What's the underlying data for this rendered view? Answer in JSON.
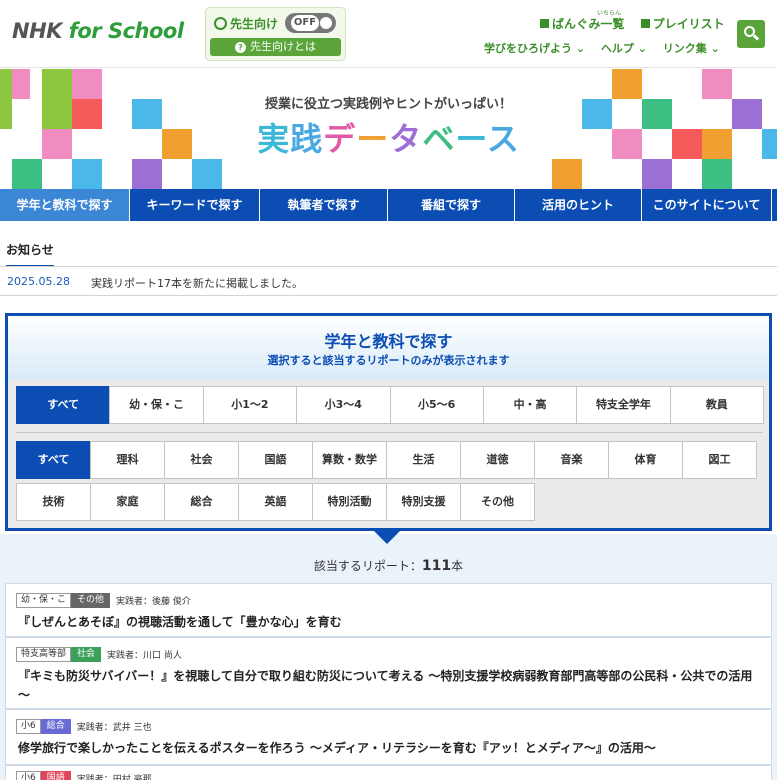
{
  "header": {
    "logo_main": "NHK ",
    "logo_accent": "for School",
    "teacher_label": "先生向け",
    "toggle_text": "OFF",
    "teacher_about": "先生向けとは",
    "top_links": [
      "ばんぐみ一覧",
      "プレイリスト"
    ],
    "ruby": "いちらん",
    "sub_links": [
      "学びをひろげよう ⌄",
      "ヘルプ ⌄",
      "リンク集 ⌄"
    ]
  },
  "banner": {
    "tagline": "授業に役立つ実践例やヒントがいっぱい！",
    "title_chars": [
      "実",
      "践",
      "デ",
      "ー",
      "タ",
      "ベ",
      "ー",
      "ス"
    ]
  },
  "nav": [
    "学年と教科で探す",
    "キーワードで探す",
    "執筆者で探す",
    "番組で探す",
    "活用のヒント",
    "このサイトについて"
  ],
  "notice": {
    "heading": "お知らせ",
    "date": "2025.05.28",
    "text": "実践リポート17本を新たに掲載しました。"
  },
  "filter": {
    "title": "学年と教科で探す",
    "subtitle": "選択すると該当するリポートのみが表示されます",
    "grades": [
      "すべて",
      "幼・保・こ",
      "小1〜2",
      "小3〜4",
      "小5〜6",
      "中・高",
      "特支全学年",
      "教員"
    ],
    "subjects_row1": [
      "すべて",
      "理科",
      "社会",
      "国語",
      "算数・数学",
      "生活",
      "道徳",
      "音楽",
      "体育",
      "図工"
    ],
    "subjects_row2": [
      "技術",
      "家庭",
      "総合",
      "英語",
      "特別活動",
      "特別支援",
      "その他"
    ]
  },
  "results": {
    "count_prefix": "該当するリポート：",
    "count": "111",
    "count_suffix": "本",
    "items": [
      {
        "grade": "幼・保・こ",
        "subject": "その他",
        "subject_color": "#666666",
        "author": "実践者：後藤 俊介",
        "title": "『しぜんとあそぼ』の視聴活動を通して「豊かな心」を育む"
      },
      {
        "grade": "特支高等部",
        "subject": "社会",
        "subject_color": "#3aa05a",
        "author": "実践者：川口 尚人",
        "title": "『キミも防災サバイバー！』を視聴して自分で取り組む防災について考える ～特別支援学校病弱教育部門高等部の公民科・公共での活用～"
      },
      {
        "grade": "小6",
        "subject": "総合",
        "subject_color": "#6a6ad4",
        "author": "実践者：武井 三也",
        "title": "修学旅行で楽しかったことを伝えるポスターを作ろう ～メディア・リテラシーを育む『アッ！とメディア～』の活用～"
      },
      {
        "grade": "小6",
        "subject": "国語",
        "subject_color": "#e0455a",
        "author": "実践者：田村 豪那",
        "title": ""
      }
    ]
  },
  "colors": {
    "nav_blue": "#0b4db3",
    "nav_active": "#3c86d6",
    "brand_green": "#3b8f2a"
  }
}
